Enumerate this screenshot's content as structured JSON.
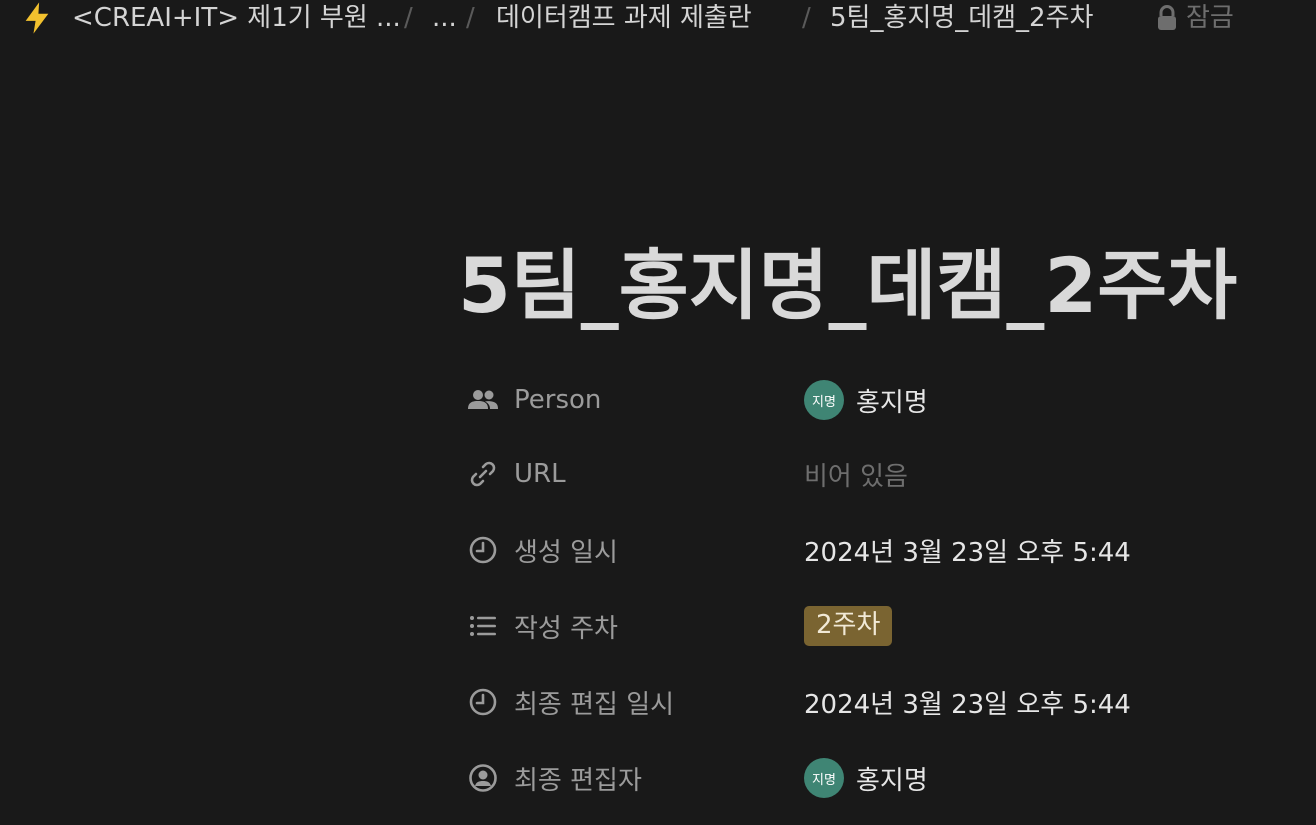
{
  "breadcrumb": {
    "icon": "lightning-icon",
    "items": [
      "<CREAI+IT> 제1기 부원 ...",
      "...",
      "데이터캠프 과제 제출란",
      "5팀_홍지명_데캠_2주차"
    ],
    "separator": "/",
    "lock_label": "잠금"
  },
  "page": {
    "title": "5팀_홍지명_데캠_2주차"
  },
  "properties": [
    {
      "name": "Person",
      "icon": "people-icon",
      "type": "person",
      "value": "홍지명",
      "avatar_text": "지명"
    },
    {
      "name": "URL",
      "icon": "link-icon",
      "type": "empty",
      "value": "비어 있음"
    },
    {
      "name": "생성 일시",
      "icon": "clock-icon",
      "type": "text",
      "value": "2024년 3월 23일 오후 5:44"
    },
    {
      "name": "작성 주차",
      "icon": "list-icon",
      "type": "tag",
      "value": "2주차"
    },
    {
      "name": "최종 편집 일시",
      "icon": "clock-icon",
      "type": "text",
      "value": "2024년 3월 23일 오후 5:44"
    },
    {
      "name": "최종 편집자",
      "icon": "user-circle-icon",
      "type": "person",
      "value": "홍지명",
      "avatar_text": "지명"
    }
  ],
  "colors": {
    "background": "#191919",
    "avatar": "#3f8574",
    "tag": "#7a6431",
    "lightning": "#f2c12e"
  }
}
